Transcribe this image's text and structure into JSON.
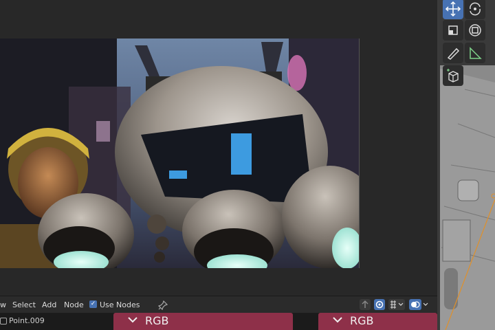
{
  "toolbar": {
    "view_label": "w",
    "select_label": "Select",
    "add_label": "Add",
    "node_label": "Node",
    "use_nodes_label": "Use Nodes",
    "use_nodes_checked": true
  },
  "node_editor": {
    "object_name": "Point.009",
    "nodes": [
      {
        "label": "RGB"
      },
      {
        "label": "RGB"
      }
    ]
  },
  "icons": {
    "move": "move-icon",
    "rotate": "rotate-icon",
    "scale": "scale-icon",
    "transform": "transform-icon",
    "annotate": "annotate-icon",
    "measure": "measure-icon",
    "add_cube": "add-cube-icon",
    "pin": "pin-icon",
    "parent": "parent-node-icon",
    "backdrop": "backdrop-icon",
    "snap": "snap-icon",
    "overlay": "overlay-icon"
  },
  "colors": {
    "accent": "#4772b3",
    "node_header": "#8e3049"
  }
}
